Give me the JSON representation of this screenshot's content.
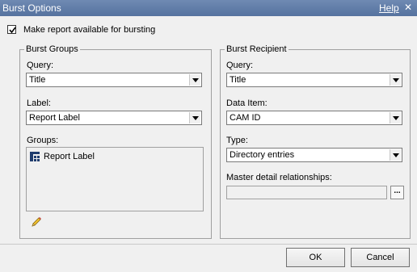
{
  "window": {
    "title": "Burst Options",
    "help_label": "Help",
    "close_glyph": "✕"
  },
  "checkbox": {
    "label": "Make report available for bursting",
    "checked": true
  },
  "burst_groups": {
    "legend": "Burst Groups",
    "query_label": "Query:",
    "query_value": "Title",
    "label_label": "Label:",
    "label_value": "Report Label",
    "groups_label": "Groups:",
    "groups_items": [
      {
        "label": "Report Label",
        "icon": "data-item-icon"
      }
    ],
    "edit_icon": "pencil-icon"
  },
  "burst_recipient": {
    "legend": "Burst Recipient",
    "query_label": "Query:",
    "query_value": "Title",
    "data_item_label": "Data Item:",
    "data_item_value": "CAM ID",
    "type_label": "Type:",
    "type_value": "Directory entries",
    "master_detail_label": "Master detail relationships:",
    "master_detail_value": "",
    "ellipsis_label": "..."
  },
  "buttons": {
    "ok": "OK",
    "cancel": "Cancel"
  }
}
